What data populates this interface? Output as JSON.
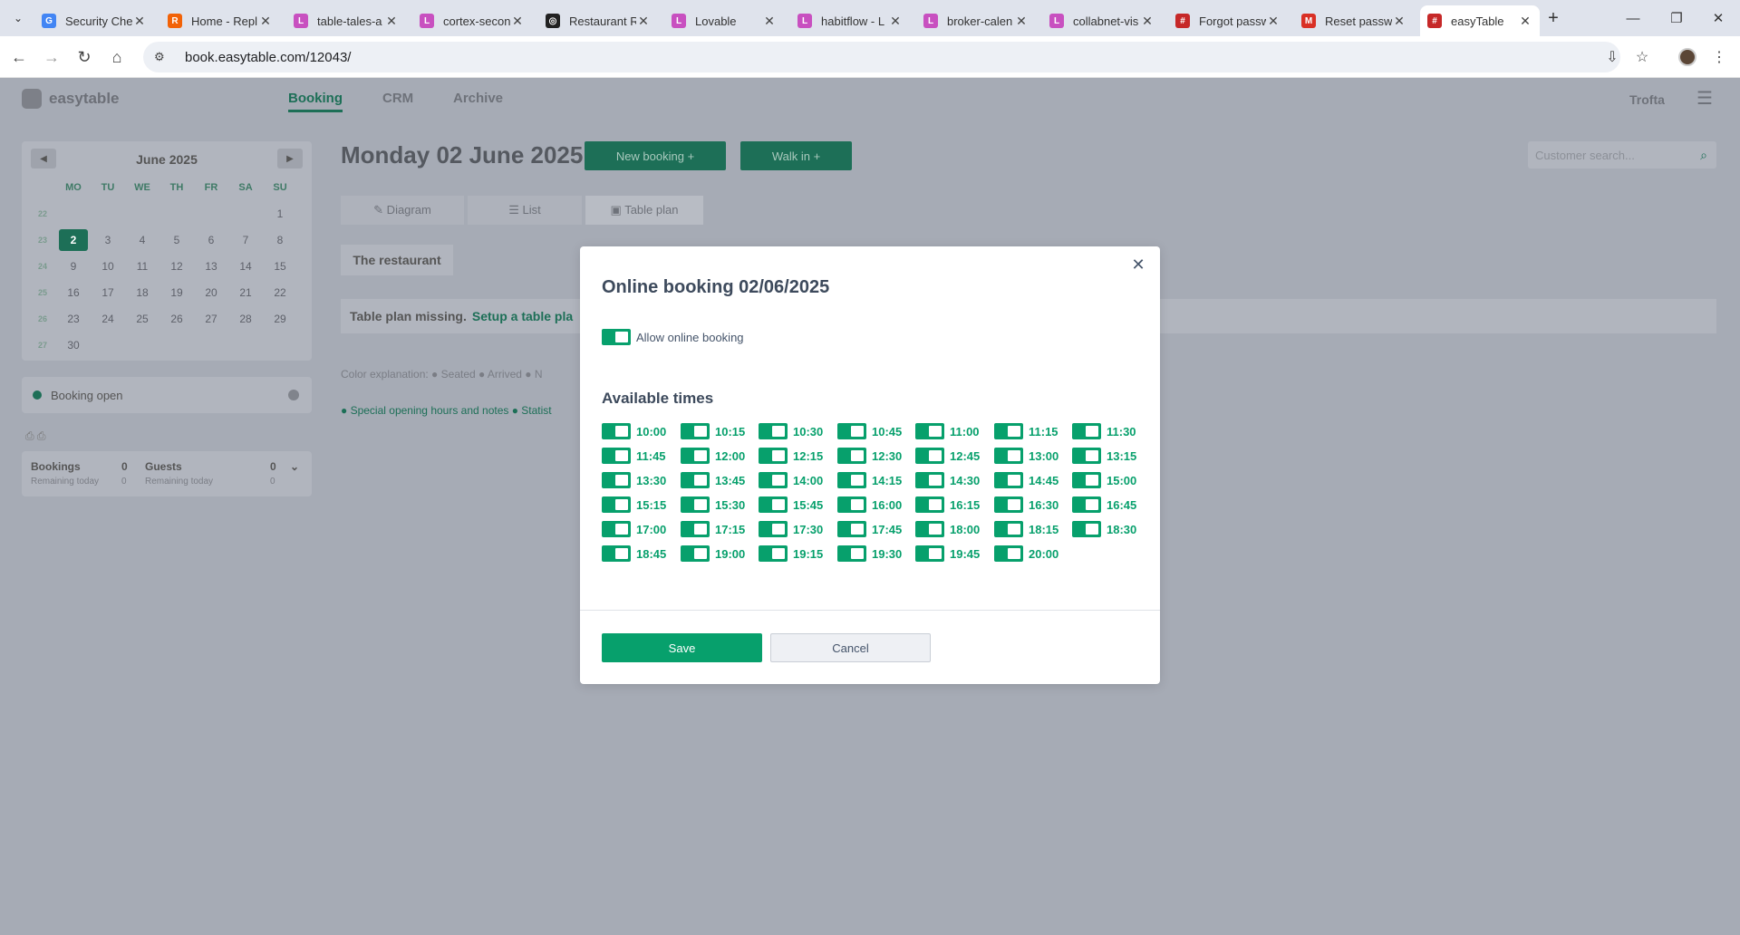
{
  "browser": {
    "tabs": [
      {
        "title": "Security Che",
        "icon": "google-icon",
        "color": "#4285f4",
        "glyph": "G"
      },
      {
        "title": "Home - Repl",
        "icon": "replit-icon",
        "color": "#f26207",
        "glyph": "R"
      },
      {
        "title": "table-tales-a",
        "icon": "lovable-icon",
        "color": "#c850c0",
        "glyph": "L"
      },
      {
        "title": "cortex-secon",
        "icon": "lovable-icon",
        "color": "#c850c0",
        "glyph": "L"
      },
      {
        "title": "Restaurant R",
        "icon": "openai-icon",
        "color": "#222222",
        "glyph": "◎"
      },
      {
        "title": "Lovable",
        "icon": "lovable-icon",
        "color": "#c850c0",
        "glyph": "L"
      },
      {
        "title": "habitflow - L",
        "icon": "lovable-icon",
        "color": "#c850c0",
        "glyph": "L"
      },
      {
        "title": "broker-calen",
        "icon": "lovable-icon",
        "color": "#c850c0",
        "glyph": "L"
      },
      {
        "title": "collabnet-vis",
        "icon": "lovable-icon",
        "color": "#c850c0",
        "glyph": "L"
      },
      {
        "title": "Forgot passw",
        "icon": "easytable-icon",
        "color": "#c62828",
        "glyph": "#"
      },
      {
        "title": "Reset passw",
        "icon": "gmail-icon",
        "color": "#d93025",
        "glyph": "M"
      },
      {
        "title": "easyTable",
        "icon": "easytable-icon",
        "color": "#c62828",
        "glyph": "#",
        "active": true
      }
    ],
    "url": "book.easytable.com/12043/"
  },
  "app": {
    "logo": "easytable",
    "nav": [
      "Booking",
      "CRM",
      "Archive"
    ],
    "user": "Trofta",
    "date_title": "Monday 02 June 2025",
    "new_booking": "New booking  +",
    "walk_in": "Walk in  +",
    "view_tabs": [
      "✎  Diagram",
      "☰  List",
      "▣  Table plan"
    ],
    "customer_search_placeholder": "Customer search...",
    "restaurant": "The restaurant",
    "plan_missing": "Table plan missing.",
    "plan_link": "Setup a table pla",
    "color_explanation": "Color explanation:  ● Seated  ● Arrived  ● N",
    "special_links": "● Special opening hours and notes   ● Statist",
    "calendar": {
      "month": "June 2025",
      "headers": [
        "MO",
        "TU",
        "WE",
        "TH",
        "FR",
        "SA",
        "SU"
      ],
      "weeks": [
        {
          "wk": "22",
          "days": [
            "",
            "",
            "",
            "",
            "",
            "",
            "1"
          ]
        },
        {
          "wk": "23",
          "days": [
            "2",
            "3",
            "4",
            "5",
            "6",
            "7",
            "8"
          ]
        },
        {
          "wk": "24",
          "days": [
            "9",
            "10",
            "11",
            "12",
            "13",
            "14",
            "15"
          ]
        },
        {
          "wk": "25",
          "days": [
            "16",
            "17",
            "18",
            "19",
            "20",
            "21",
            "22"
          ]
        },
        {
          "wk": "26",
          "days": [
            "23",
            "24",
            "25",
            "26",
            "27",
            "28",
            "29"
          ]
        },
        {
          "wk": "27",
          "days": [
            "30",
            "",
            "",
            "",
            "",
            "",
            ""
          ]
        }
      ],
      "selected": "2"
    },
    "booking_open": "Booking open",
    "stats": {
      "bookings_label": "Bookings",
      "bookings_value": "0",
      "bookings_sub": "Remaining today",
      "bookings_sub_value": "0",
      "guests_label": "Guests",
      "guests_value": "0",
      "guests_sub": "Remaining today",
      "guests_sub_value": "0"
    }
  },
  "modal": {
    "title": "Online booking 02/06/2025",
    "allow_label": "Allow online booking",
    "allow_on": true,
    "available_title": "Available times",
    "times": [
      "10:00",
      "10:15",
      "10:30",
      "10:45",
      "11:00",
      "11:15",
      "11:30",
      "11:45",
      "12:00",
      "12:15",
      "12:30",
      "12:45",
      "13:00",
      "13:15",
      "13:30",
      "13:45",
      "14:00",
      "14:15",
      "14:30",
      "14:45",
      "15:00",
      "15:15",
      "15:30",
      "15:45",
      "16:00",
      "16:15",
      "16:30",
      "16:45",
      "17:00",
      "17:15",
      "17:30",
      "17:45",
      "18:00",
      "18:15",
      "18:30",
      "18:45",
      "19:00",
      "19:15",
      "19:30",
      "19:45",
      "20:00"
    ],
    "save_label": "Save",
    "cancel_label": "Cancel",
    "close_symbol": "✕",
    "accent": "#07a06c"
  }
}
